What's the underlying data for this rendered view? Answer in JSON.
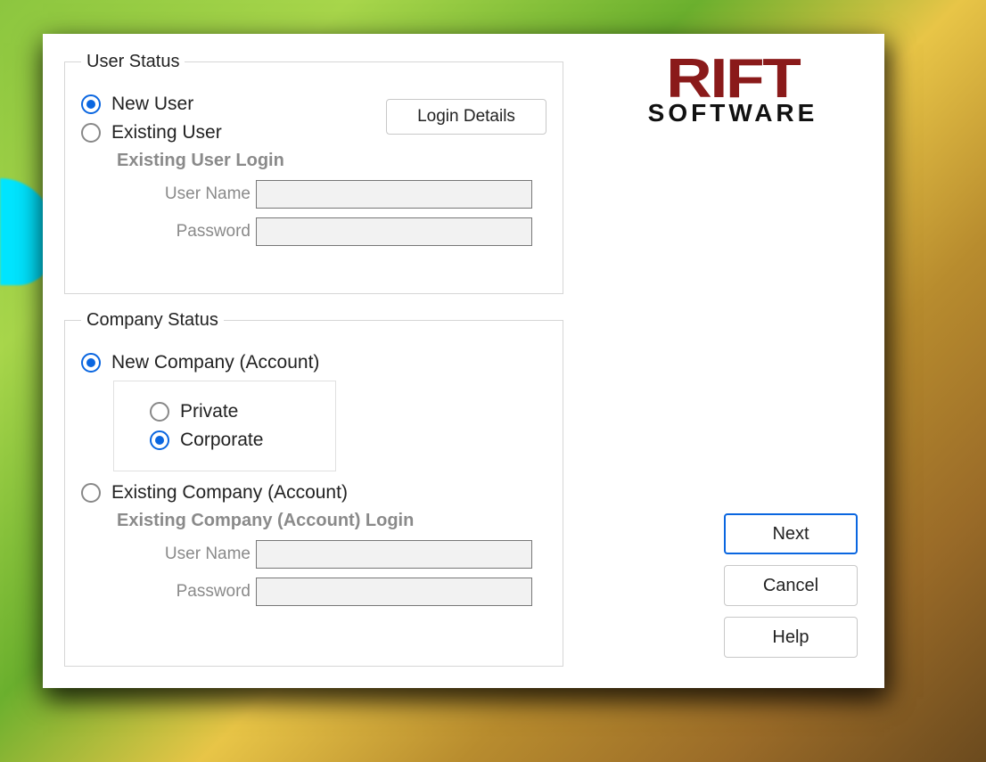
{
  "logo": {
    "line1": "RIFT",
    "line2": "SOFTWARE"
  },
  "userStatus": {
    "legend": "User Status",
    "newUser": "New User",
    "existingUser": "Existing User",
    "loginDetailsBtn": "Login Details",
    "loginSection": {
      "title": "Existing User Login",
      "userNameLabel": "User  Name",
      "userNameValue": "",
      "passwordLabel": "Password",
      "passwordValue": ""
    },
    "selected": "new"
  },
  "companyStatus": {
    "legend": "Company Status",
    "newCompany": "New Company (Account)",
    "type": {
      "private": "Private",
      "corporate": "Corporate",
      "selected": "corporate"
    },
    "existingCompany": "Existing Company (Account)",
    "loginSection": {
      "title": "Existing Company (Account) Login",
      "userNameLabel": "User  Name",
      "userNameValue": "",
      "passwordLabel": "Password",
      "passwordValue": ""
    },
    "selected": "new"
  },
  "buttons": {
    "next": "Next",
    "cancel": "Cancel",
    "help": "Help"
  }
}
